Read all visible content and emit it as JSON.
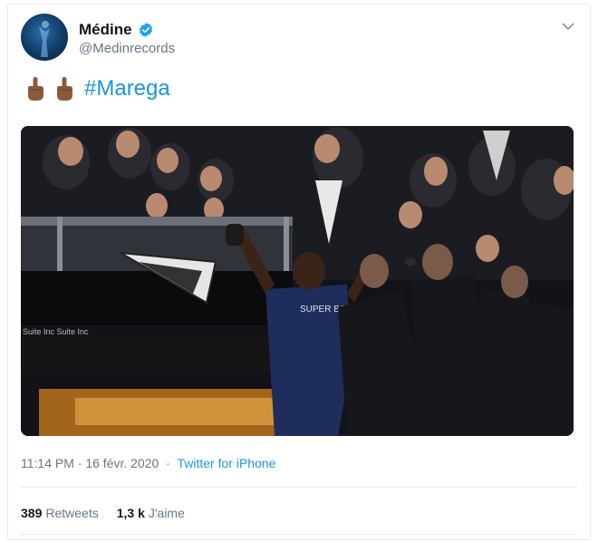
{
  "tweet": {
    "display_name": "Médine",
    "handle": "@Medinrecords",
    "hashtag": "#Marega",
    "emoji": [
      "middle-finger-emoji",
      "middle-finger-emoji"
    ],
    "timestamp": "11:14 PM · 16 févr. 2020",
    "source": "Twitter for iPhone",
    "retweets_count": "389",
    "retweets_label": "Retweets",
    "likes_count": "1,3 k",
    "likes_label": "J'aime",
    "jersey_text": "SUPER BOCK"
  },
  "colors": {
    "link": "#1b95e0",
    "verified": "#1da1f2",
    "muted": "#657786",
    "text": "#14171a"
  },
  "icons": {
    "verified": "verified-badge-icon",
    "caret": "chevron-down-icon"
  }
}
